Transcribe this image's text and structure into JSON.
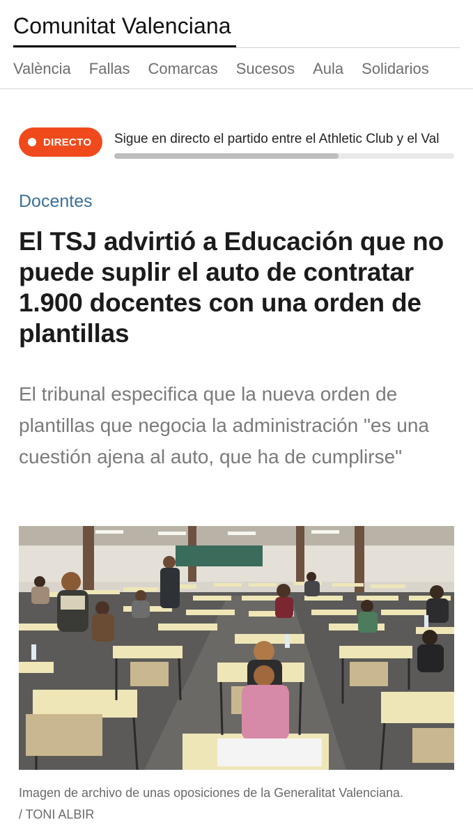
{
  "section": {
    "title": "Comunitat Valenciana"
  },
  "nav": {
    "items": [
      {
        "label": "València"
      },
      {
        "label": "Fallas"
      },
      {
        "label": "Comarcas"
      },
      {
        "label": "Sucesos"
      },
      {
        "label": "Aula"
      },
      {
        "label": "Solidarios"
      }
    ]
  },
  "live": {
    "badge": "DIRECTO",
    "headline": "Sigue en directo el partido entre el Athletic Club y el Val",
    "progress": 0.66,
    "badge_color": "#f04a1c"
  },
  "article": {
    "category": "Docentes",
    "headline": "El TSJ advirtió a Educación que no puede suplir el auto de contratar 1.900 docentes con una orden de plantillas",
    "subheadline": "El tribunal especifica que la nueva orden de plantillas que negocia la administración \"es una cuestión ajena al auto, que ha de cumplirse\"",
    "photo_caption": "Imagen de archivo de unas oposiciones de la Generalitat Valenciana.",
    "photo_credit": "/ TONI ALBIR",
    "category_color": "#3b6f99"
  }
}
